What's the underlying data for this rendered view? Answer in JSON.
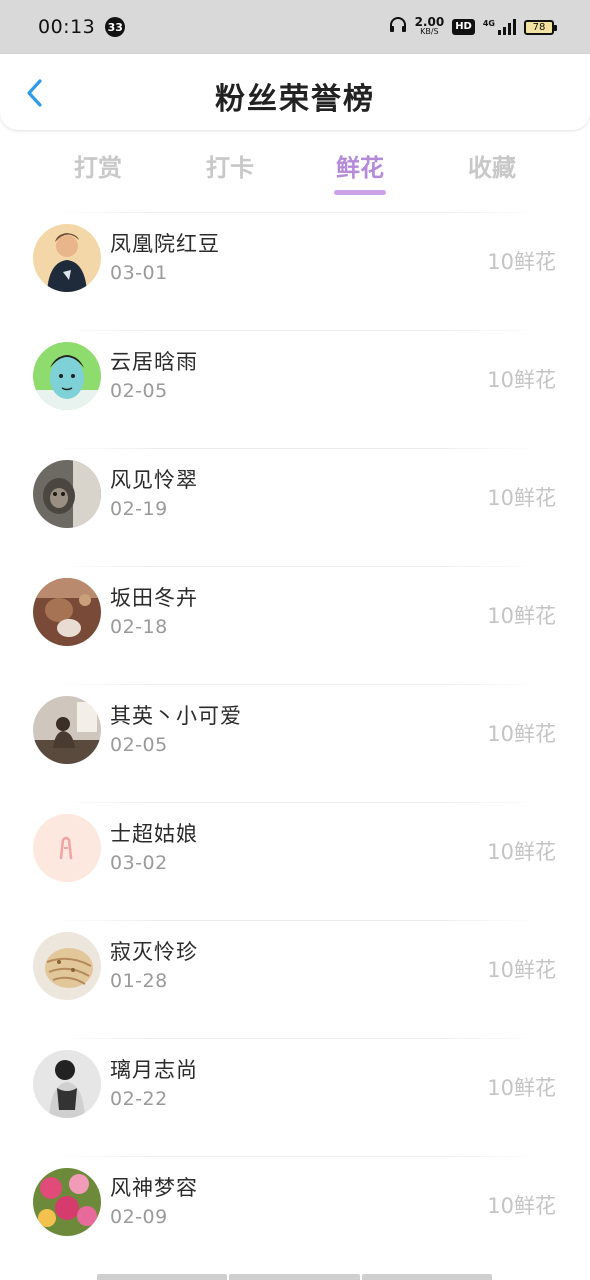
{
  "status_bar": {
    "time": "00:13",
    "notification_count": "33",
    "net_speed": "2.00",
    "net_speed_unit": "KB/S",
    "hd_label": "HD",
    "network": "4G",
    "battery": "78"
  },
  "header": {
    "title": "粉丝荣誉榜"
  },
  "tabs": [
    {
      "label": "打赏",
      "active": false
    },
    {
      "label": "打卡",
      "active": false
    },
    {
      "label": "鲜花",
      "active": true
    },
    {
      "label": "收藏",
      "active": false
    }
  ],
  "colors": {
    "accent": "#b58ad9",
    "back_arrow": "#2f9be8"
  },
  "fans": [
    {
      "name": "凤凰院红豆",
      "date": "03-01",
      "amount": "10鲜花",
      "avatar": "avatar-boy-tshirt"
    },
    {
      "name": "云居晗雨",
      "date": "02-05",
      "amount": "10鲜花",
      "avatar": "avatar-cartoon-green"
    },
    {
      "name": "风见怜翠",
      "date": "02-19",
      "amount": "10鲜花",
      "avatar": "avatar-monkey"
    },
    {
      "name": "坂田冬卉",
      "date": "02-18",
      "amount": "10鲜花",
      "avatar": "avatar-cafe"
    },
    {
      "name": "其英丶小可爱",
      "date": "02-05",
      "amount": "10鲜花",
      "avatar": "avatar-room"
    },
    {
      "name": "士超姑娘",
      "date": "03-02",
      "amount": "10鲜花",
      "avatar": "avatar-pink-figure"
    },
    {
      "name": "寂灭怜珍",
      "date": "01-28",
      "amount": "10鲜花",
      "avatar": "avatar-seashell"
    },
    {
      "name": "璃月志尚",
      "date": "02-22",
      "amount": "10鲜花",
      "avatar": "avatar-bw-person"
    },
    {
      "name": "风神梦容",
      "date": "02-09",
      "amount": "10鲜花",
      "avatar": "avatar-flowers"
    }
  ]
}
